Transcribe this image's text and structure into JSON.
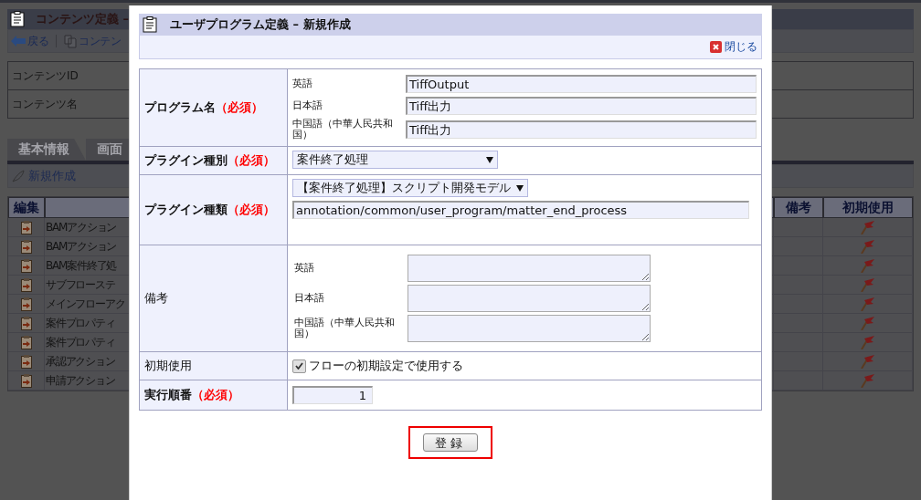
{
  "background": {
    "header": {
      "title": "コンテンツ定義 –"
    },
    "toolbar": [
      {
        "kind": "back",
        "label": "戻る"
      },
      {
        "kind": "copy",
        "label": "コンテン"
      }
    ],
    "info_rows": [
      {
        "label": "コンテンツID"
      },
      {
        "label": "コンテンツ名"
      }
    ],
    "tabs": [
      {
        "label": "基本情報",
        "selected": false
      },
      {
        "label": "画面",
        "selected": false
      }
    ],
    "new_button": "新規作成",
    "table": {
      "columns": [
        {
          "label": "編集"
        },
        {
          "label": "備考"
        },
        {
          "label": "初期使用"
        }
      ],
      "rows": [
        {
          "name": "BAMアクション"
        },
        {
          "name": "BAMアクション"
        },
        {
          "name": "BAM案件終了処"
        },
        {
          "name": "サブフローステ"
        },
        {
          "name": "メインフローアク"
        },
        {
          "name": "案件プロパティ"
        },
        {
          "name": "案件プロパティ"
        },
        {
          "name": "承認アクション"
        },
        {
          "name": "申請アクション"
        }
      ]
    }
  },
  "dialog": {
    "title": "ユーザプログラム定義 – 新規作成",
    "close": "閉じる",
    "fields": [
      {
        "kind": "multilang_input",
        "label": "プログラム名",
        "required": "（必須）",
        "entries": [
          {
            "lang": "英語",
            "value": "TiffOutput"
          },
          {
            "lang": "日本語",
            "value": "Tiff出力"
          },
          {
            "lang": "中国語（中華人民共和国）",
            "value": "Tiff出力"
          }
        ]
      },
      {
        "kind": "select",
        "label": "プラグイン種別",
        "required": "（必須）",
        "value": "案件終了処理"
      },
      {
        "kind": "select_path",
        "label": "プラグイン種類",
        "required": "（必須）",
        "value": "【案件終了処理】スクリプト開発モデル",
        "path": "annotation/common/user_program/matter_end_process"
      },
      {
        "kind": "multilang_textarea",
        "label": "備考",
        "entries": [
          {
            "lang": "英語"
          },
          {
            "lang": "日本語"
          },
          {
            "lang": "中国語（中華人民共和国）"
          }
        ]
      },
      {
        "kind": "checkbox",
        "label": "初期使用",
        "text": "フローの初期設定で使用する",
        "checked": true
      },
      {
        "kind": "number",
        "label": "実行順番",
        "required": "（必須）",
        "value": "1"
      }
    ],
    "submit": "登録"
  }
}
